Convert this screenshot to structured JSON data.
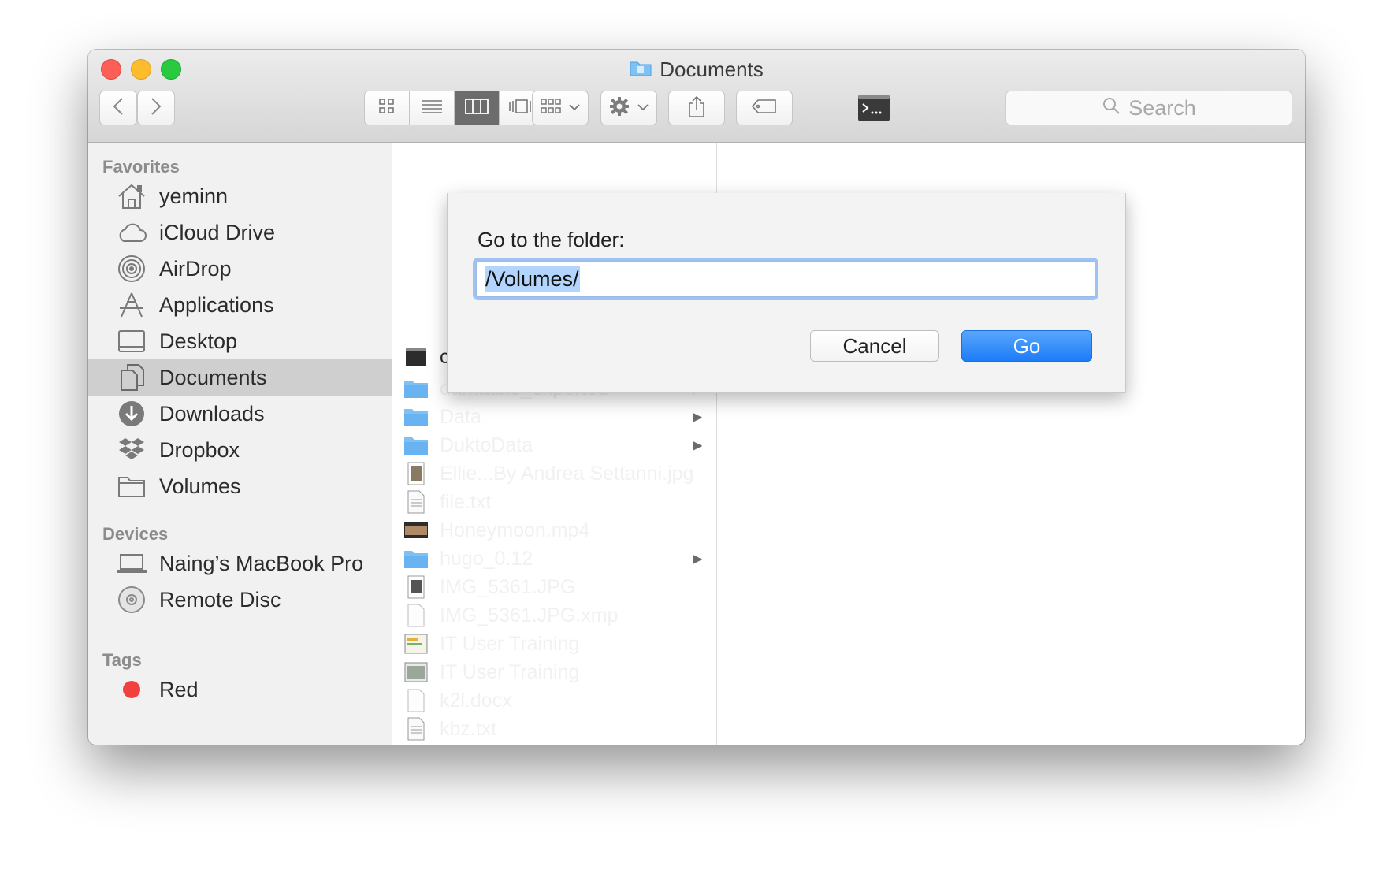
{
  "window": {
    "title": "Documents",
    "accent_color": "#1c7cf7"
  },
  "toolbar": {
    "back_icon": "chevron-left-icon",
    "forward_icon": "chevron-right-icon",
    "view_modes": [
      "icon-view-icon",
      "list-view-icon",
      "column-view-icon",
      "cover-flow-icon"
    ],
    "active_view": "column-view-icon",
    "arrange_icon": "arrange-grid-icon",
    "action_icon": "gear-icon",
    "share_icon": "share-icon",
    "tag_icon": "tag-icon",
    "terminal_icon": "terminal-icon",
    "search_placeholder": "Search"
  },
  "sidebar": {
    "favorites_header": "Favorites",
    "favorites": [
      {
        "label": "yeminn",
        "icon": "home-icon"
      },
      {
        "label": "iCloud Drive",
        "icon": "cloud-icon"
      },
      {
        "label": "AirDrop",
        "icon": "airdrop-icon"
      },
      {
        "label": "Applications",
        "icon": "applications-icon"
      },
      {
        "label": "Desktop",
        "icon": "desktop-icon"
      },
      {
        "label": "Documents",
        "icon": "documents-icon",
        "selected": true
      },
      {
        "label": "Downloads",
        "icon": "downloads-icon"
      },
      {
        "label": "Dropbox",
        "icon": "dropbox-icon"
      },
      {
        "label": "Volumes",
        "icon": "folder-icon"
      }
    ],
    "devices_header": "Devices",
    "devices": [
      {
        "label": "Naing’s MacBook Pro",
        "icon": "laptop-icon"
      },
      {
        "label": "Remote Disc",
        "icon": "disc-icon"
      }
    ],
    "tags_header": "Tags",
    "tags": [
      {
        "label": "Red",
        "color": "#f2403c"
      }
    ]
  },
  "files": [
    {
      "name": "cbforex",
      "icon": "terminal-file-icon",
      "folder": false
    },
    {
      "name": "darktable_exported",
      "icon": "folder-icon",
      "folder": true
    },
    {
      "name": "Data",
      "icon": "folder-icon",
      "folder": true
    },
    {
      "name": "DuktoData",
      "icon": "folder-icon",
      "folder": true
    },
    {
      "name": "Ellie...By Andrea Settanni.jpg",
      "icon": "image-file-icon",
      "folder": false
    },
    {
      "name": "file.txt",
      "icon": "text-file-icon",
      "folder": false
    },
    {
      "name": "Honeymoon.mp4",
      "icon": "video-file-icon",
      "folder": false
    },
    {
      "name": "hugo_0.12",
      "icon": "folder-icon",
      "folder": true
    },
    {
      "name": "IMG_5361.JPG",
      "icon": "image-file-icon",
      "folder": false
    },
    {
      "name": "IMG_5361.JPG.xmp",
      "icon": "blank-file-icon",
      "folder": false
    },
    {
      "name": "IT User Training",
      "icon": "presentation-file-icon",
      "folder": false
    },
    {
      "name": "IT User Training",
      "icon": "presentation-file-icon",
      "folder": false
    },
    {
      "name": "k2l.docx",
      "icon": "blank-file-icon",
      "folder": false
    },
    {
      "name": "kbz.txt",
      "icon": "text-file-icon",
      "folder": false
    }
  ],
  "dialog": {
    "label": "Go to the folder:",
    "input_value": "/Volumes/",
    "cancel_label": "Cancel",
    "go_label": "Go"
  }
}
